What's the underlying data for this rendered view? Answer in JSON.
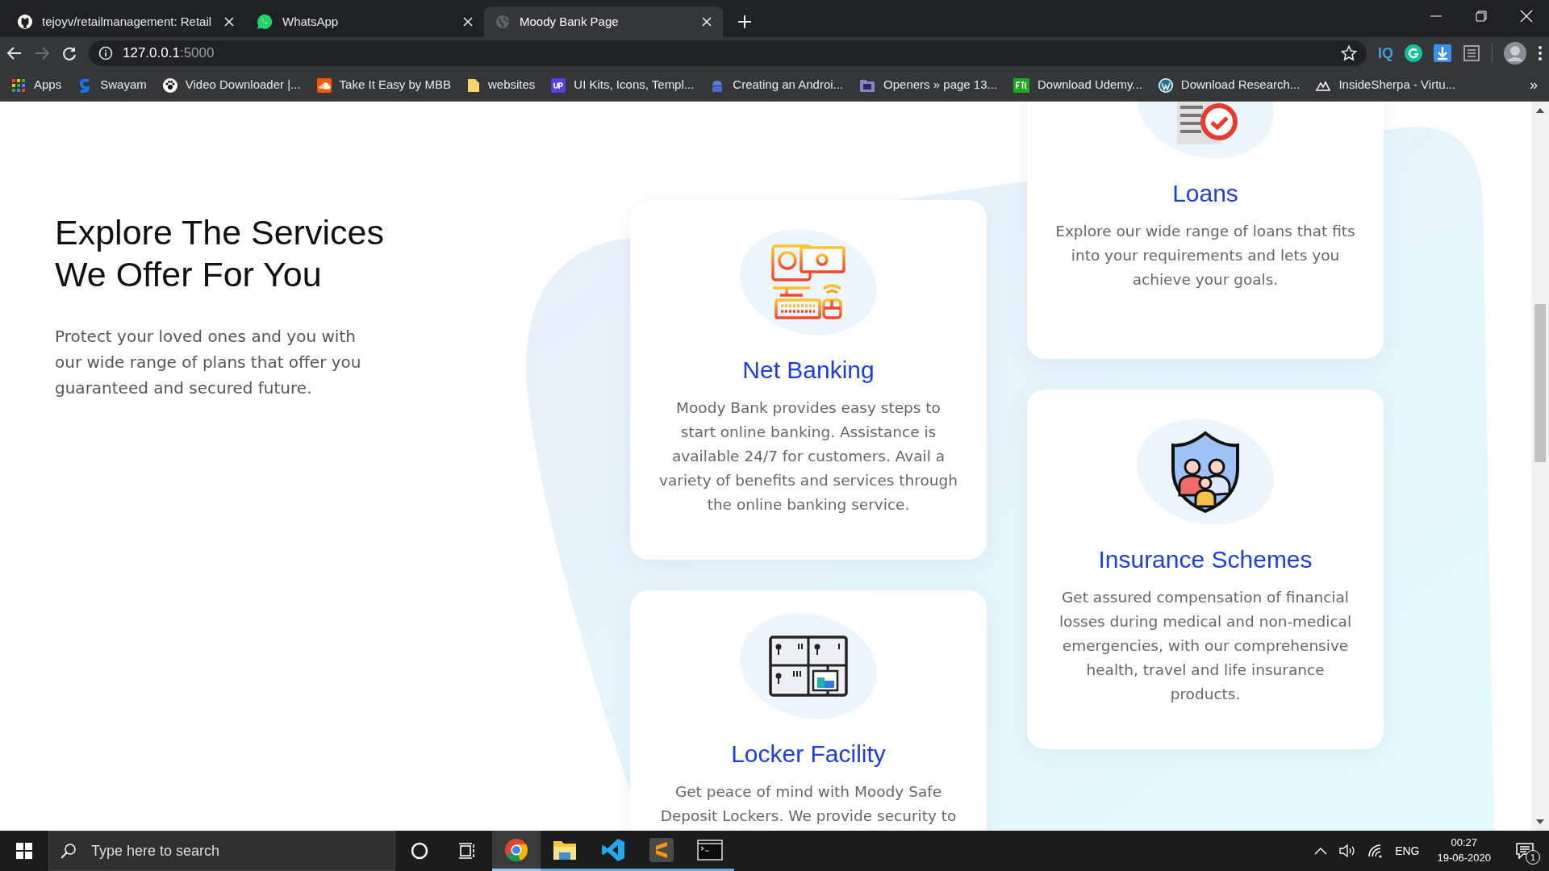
{
  "browser": {
    "tabs": [
      {
        "title": "tejoyv/retailmanagement: Retail",
        "kind": "github",
        "selected": false
      },
      {
        "title": "WhatsApp",
        "kind": "whatsapp",
        "selected": false
      },
      {
        "title": "Moody Bank Page",
        "kind": "globe",
        "selected": true
      }
    ],
    "back": {
      "disabled": false
    },
    "forward": {
      "disabled": true
    },
    "address": {
      "host": "127.0.0.1",
      "port": ":5000"
    },
    "extensions": [
      {
        "kind": "iq",
        "label": "IQ"
      },
      {
        "kind": "grammarly"
      },
      {
        "kind": "download"
      },
      {
        "kind": "reader"
      }
    ],
    "bookmarks": [
      {
        "label": "Apps",
        "kind": "apps"
      },
      {
        "label": "Swayam",
        "kind": "swayam"
      },
      {
        "label": "Video Downloader |...",
        "kind": "paw"
      },
      {
        "label": "Take It Easy by MBB",
        "kind": "cloud"
      },
      {
        "label": "websites",
        "kind": "folder"
      },
      {
        "label": "UI Kits, Icons, Templ...",
        "kind": "up"
      },
      {
        "label": "Creating an Androi...",
        "kind": "android"
      },
      {
        "label": "Openers » page 13...",
        "kind": "ae"
      },
      {
        "label": "Download Udemy...",
        "kind": "ftu"
      },
      {
        "label": "Download Research...",
        "kind": "wordpress"
      },
      {
        "label": "InsideSherpa - Virtu...",
        "kind": "mountain"
      }
    ],
    "bookmarks_overflow": "»"
  },
  "page": {
    "heading": "Explore The Services We Offer For You",
    "intro": "Protect your loved ones and you with our wide range of plans that offer you guaranteed and secured future.",
    "services_column_1": [
      {
        "kind": "computer",
        "title": "Net Banking",
        "description": "Moody Bank provides easy steps to start online banking. Assistance is available 24/7 for customers. Avail a variety of benefits and services through the online banking service."
      },
      {
        "kind": "locker",
        "title": "Locker Facility",
        "description": "Get peace of mind with Moody Safe Deposit Lockers. We provide security to"
      }
    ],
    "services_column_2": [
      {
        "kind": "document",
        "title": "Loans",
        "description": "Explore our wide range of loans that fits into your requirements and lets you achieve your goals."
      },
      {
        "kind": "shield",
        "title": "Insurance Schemes",
        "description": "Get assured compensation of financial losses during medical and non-medical emergencies, with our comprehensive health, travel and life insurance products."
      }
    ]
  },
  "taskbar": {
    "search": {
      "placeholder": "Type here to search"
    },
    "apps": [
      {
        "kind": "chrome",
        "selected": true
      },
      {
        "kind": "explorer",
        "selected": false
      },
      {
        "kind": "vscode",
        "selected": false
      },
      {
        "kind": "sublime",
        "selected": false
      },
      {
        "kind": "terminal",
        "selected": false
      }
    ],
    "language": "ENG",
    "time": "00:27",
    "date": "19-06-2020",
    "notifications": "1"
  }
}
